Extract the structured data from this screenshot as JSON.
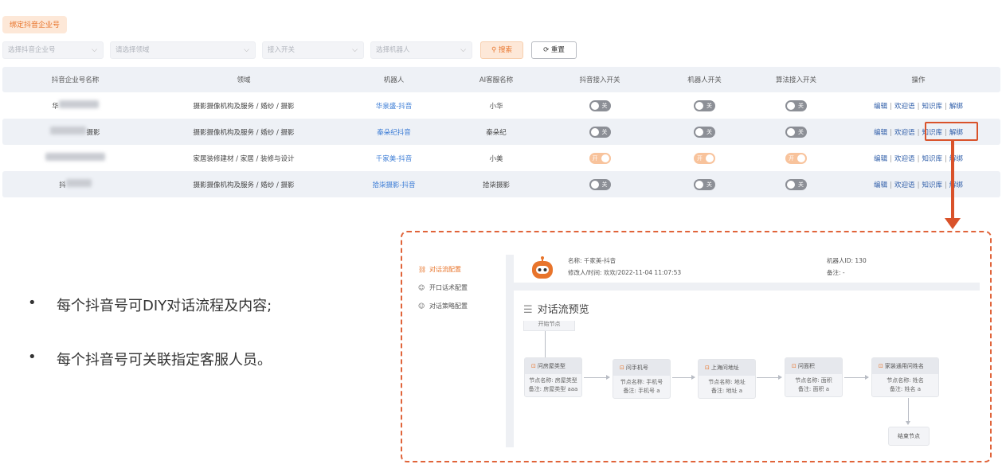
{
  "bind_button": "绑定抖音企业号",
  "filters": [
    {
      "placeholder": "选择抖音企业号"
    },
    {
      "placeholder": "请选择领域"
    },
    {
      "placeholder": "接入开关"
    },
    {
      "placeholder": "选择机器人"
    }
  ],
  "search_button": "搜索",
  "reset_button": "重置",
  "table": {
    "headers": [
      "抖音企业号名称",
      "领域",
      "机器人",
      "AI客服名称",
      "抖音接入开关",
      "机器人开关",
      "算法接入开关",
      "操作"
    ],
    "rows": [
      {
        "name": "华",
        "domain": "摄影摄像机构及服务 / 婚纱 / 摄影",
        "robot": "华泉盛-抖音",
        "ai_name": "小华",
        "douyin": "关",
        "robot_switch": "关",
        "algo": "关"
      },
      {
        "name": "摄影",
        "domain": "摄影摄像机构及服务 / 婚纱 / 摄影",
        "robot": "秦朵纪抖音",
        "ai_name": "秦朵纪",
        "douyin": "关",
        "robot_switch": "关",
        "algo": "关"
      },
      {
        "name": "",
        "domain": "家居装修建材 / 家居 / 装修与设计",
        "robot": "千家美-抖音",
        "ai_name": "小美",
        "douyin": "开",
        "robot_switch": "开",
        "algo": "开"
      },
      {
        "name": "抖",
        "domain": "摄影摄像机构及服务 / 婚纱 / 摄影",
        "robot": "拾柒摄影-抖音",
        "ai_name": "拾柒摄影",
        "douyin": "关",
        "robot_switch": "关",
        "algo": "关"
      }
    ],
    "ops": [
      "编辑",
      "欢迎语",
      "知识库",
      "解绑"
    ]
  },
  "bullets": [
    "每个抖音号可DIY对话流程及内容;",
    "每个抖音号可关联指定客服人员。"
  ],
  "preview": {
    "menu": [
      "对话流配置",
      "开口话术配置",
      "对话策略配置"
    ],
    "name_line": "名称: 千家美-抖音",
    "modified_line": "修改人/时间: 欢欢/2022-11-04 11:07:53",
    "robot_id": "机器人ID: 130",
    "remark": "备注: -",
    "title": "对话流预览",
    "start_fragment": "开始节点",
    "nodes": [
      {
        "title": "问房屋类型",
        "l1": "节点名称: 房屋类型",
        "l2": "备注: 房屋类型 aaa"
      },
      {
        "title": "问手机号",
        "l1": "节点名称: 手机号",
        "l2": "备注: 手机号 a"
      },
      {
        "title": "上海问地址",
        "l1": "节点名称: 地址",
        "l2": "备注: 地址 a"
      },
      {
        "title": "问面积",
        "l1": "节点名称: 面积",
        "l2": "备注: 面积 a"
      },
      {
        "title": "家装通用问姓名",
        "l1": "节点名称: 姓名",
        "l2": "备注: 姓名 a"
      }
    ],
    "end_node": "结束节点"
  },
  "colors": {
    "accent": "#e8742b",
    "highlight": "#d9522a",
    "link": "#3a7bd5"
  }
}
